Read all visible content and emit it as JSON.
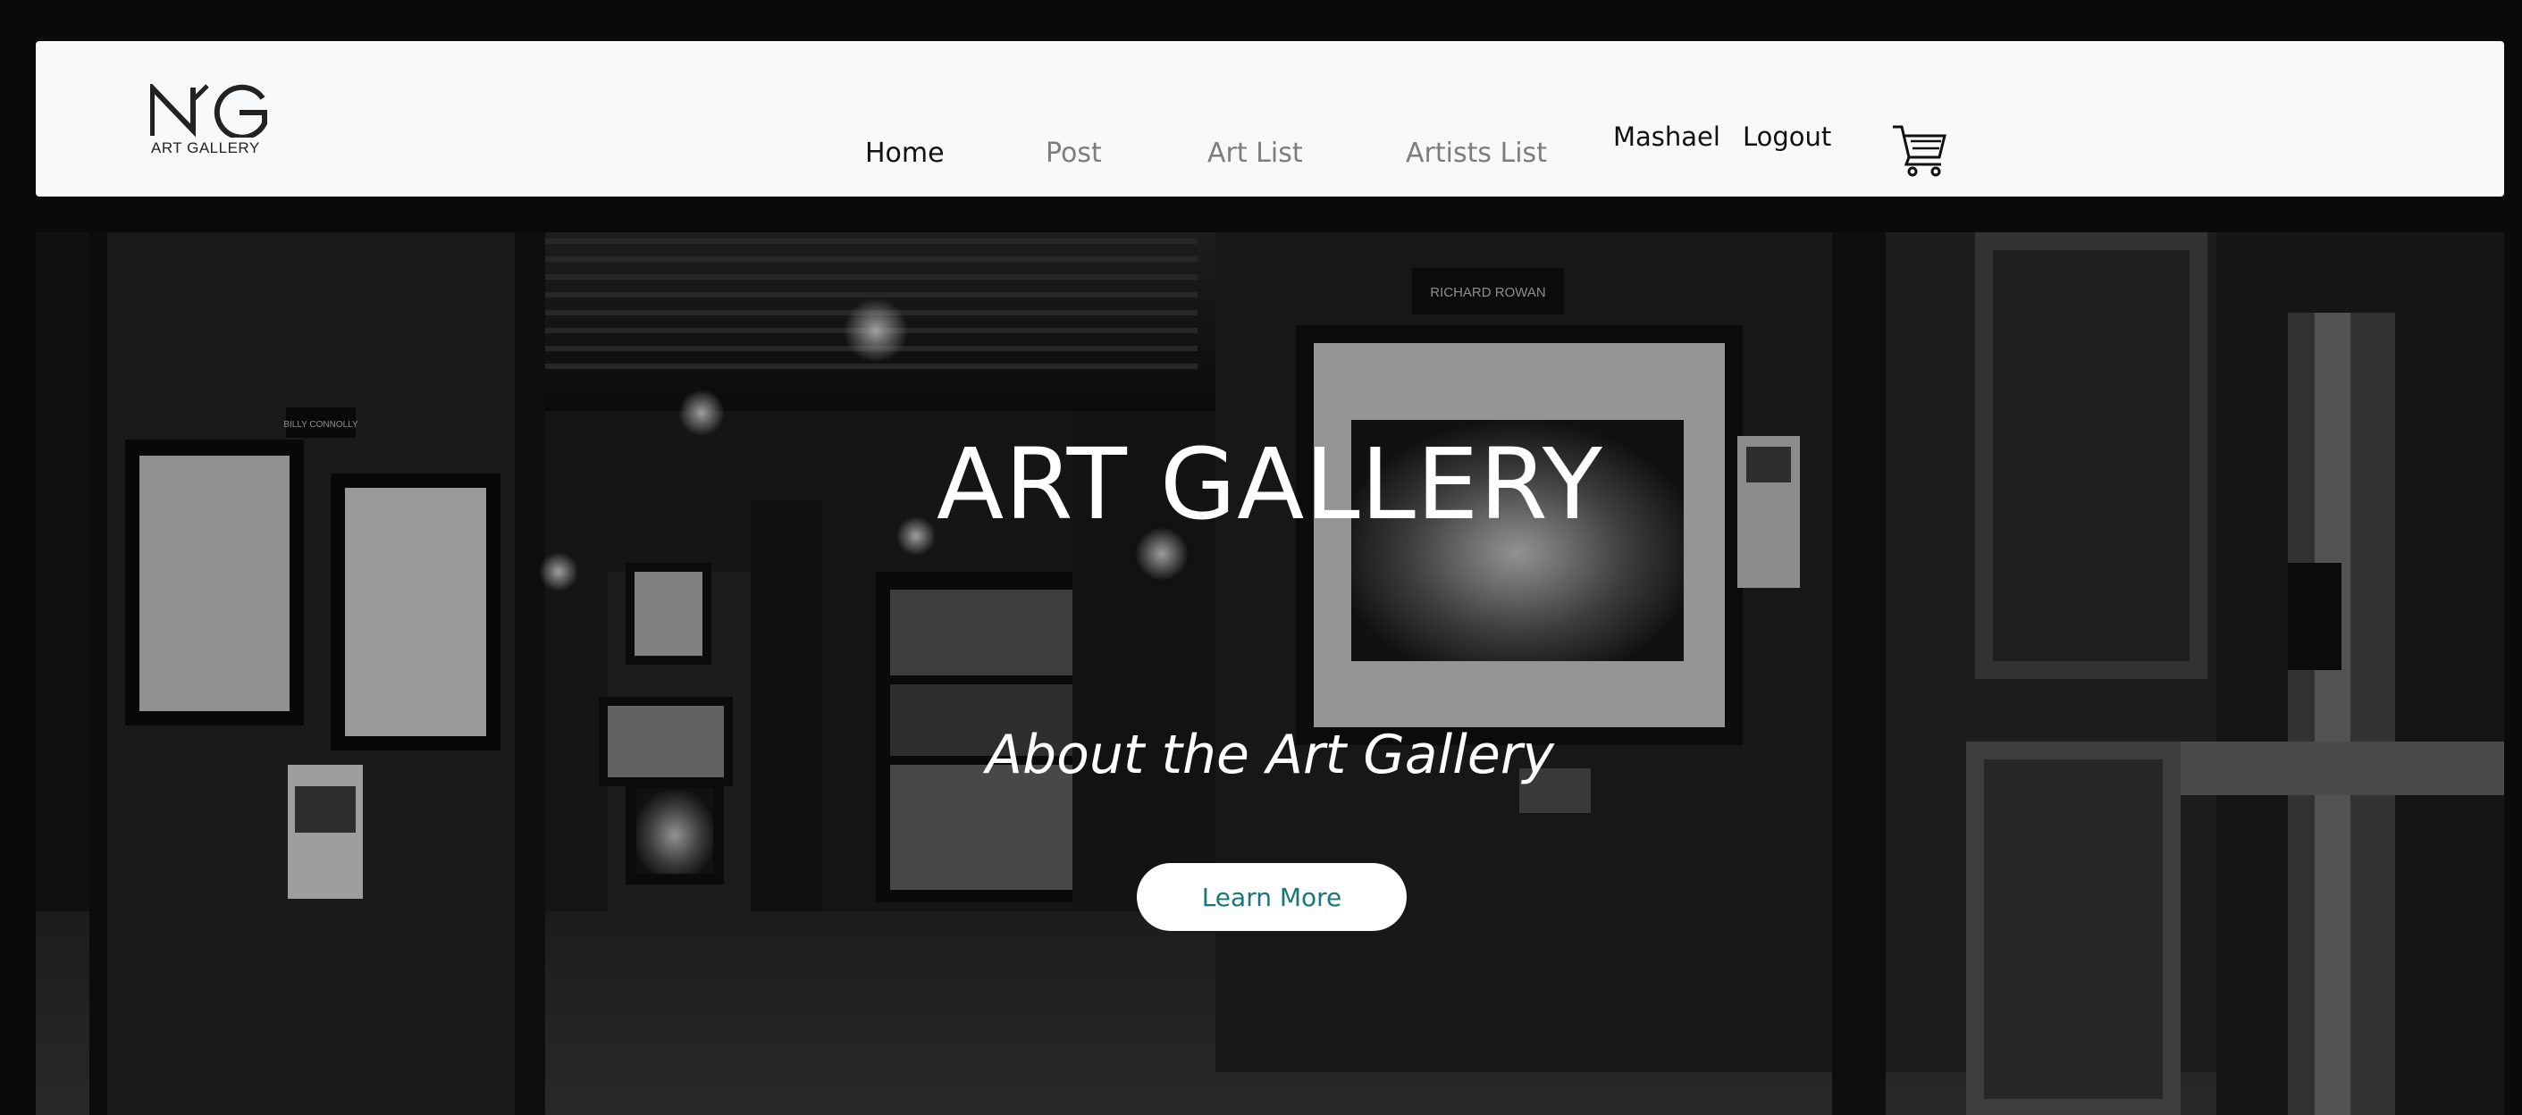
{
  "brand": {
    "logo_text": "ART GALLERY",
    "logo_mark": "NG"
  },
  "nav": {
    "items": [
      {
        "label": "Home"
      },
      {
        "label": "Post"
      },
      {
        "label": "Art List"
      },
      {
        "label": "Artists List"
      }
    ],
    "user_name": "Mashael",
    "logout_label": "Logout",
    "cart_icon": "cart-icon"
  },
  "hero": {
    "title": "ART GALLERY",
    "subtitle": "About the Art Gallery",
    "button_label": "Learn More",
    "signs": [
      "BILLY CONNOLLY",
      "RICHARD ROWAN"
    ]
  },
  "colors": {
    "navbar_bg": "#f8f9fa",
    "page_bg": "#0a0a0a",
    "active_link": "#111111",
    "inactive_link": "#7d7d7d",
    "button_text": "#17767b"
  }
}
